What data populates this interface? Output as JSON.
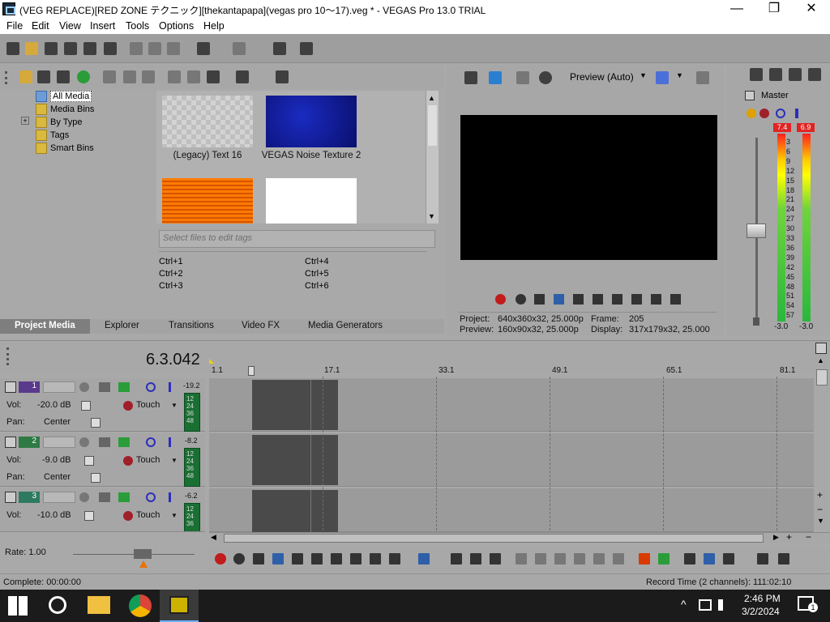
{
  "window": {
    "title": "(VEG REPLACE)[RED ZONE テクニック][thekantapapa](vegas pro 10〜17).veg * - VEGAS Pro 13.0 TRIAL",
    "minimize": "—",
    "maximize": "❐",
    "close": "✕"
  },
  "menu": [
    "File",
    "Edit",
    "View",
    "Insert",
    "Tools",
    "Options",
    "Help"
  ],
  "tree": {
    "items": [
      "All Media",
      "Media Bins",
      "By Type",
      "Tags",
      "Smart Bins"
    ],
    "expander": "+"
  },
  "media": {
    "items": [
      "(Legacy) Text 16",
      "VEGAS Noise Texture 2"
    ],
    "tag_placeholder": "Select files to edit tags",
    "shortcuts": [
      "Ctrl+1",
      "Ctrl+2",
      "Ctrl+3",
      "Ctrl+4",
      "Ctrl+5",
      "Ctrl+6"
    ]
  },
  "tabs": [
    "Project Media",
    "Explorer",
    "Transitions",
    "Video FX",
    "Media Generators"
  ],
  "preview": {
    "mode": "Preview (Auto)",
    "project_label": "Project:",
    "project_value": "640x360x32, 25.000p",
    "preview_label": "Preview:",
    "preview_value": "160x90x32, 25.000p",
    "frame_label": "Frame:",
    "frame_value": "205",
    "display_label": "Display:",
    "display_value": "317x179x32, 25.000"
  },
  "master": {
    "title": "Master",
    "peak_left": "7.4",
    "peak_right": "6.9",
    "scale": [
      "3",
      "6",
      "9",
      "12",
      "15",
      "18",
      "21",
      "24",
      "27",
      "30",
      "33",
      "36",
      "39",
      "42",
      "45",
      "48",
      "51",
      "54",
      "57"
    ],
    "level_left": "-3.0",
    "level_right": "-3.0"
  },
  "timeline": {
    "time": "6.3.042",
    "ruler": [
      "1.1",
      "17.1",
      "33.1",
      "49.1",
      "65.1",
      "81.1"
    ],
    "tracks": [
      {
        "num": "1",
        "peak": "-19.2",
        "vol_label": "Vol:",
        "vol": "-20.0 dB",
        "pan_label": "Pan:",
        "pan": "Center",
        "mode": "Touch",
        "meter": [
          "12",
          "24",
          "36",
          "48"
        ]
      },
      {
        "num": "2",
        "peak": "-8.2",
        "vol_label": "Vol:",
        "vol": "-9.0 dB",
        "pan_label": "Pan:",
        "pan": "Center",
        "mode": "Touch",
        "meter": [
          "12",
          "24",
          "36",
          "48"
        ]
      },
      {
        "num": "3",
        "peak": "-6.2",
        "vol_label": "Vol:",
        "vol": "-10.0 dB",
        "pan_label": "Pan:",
        "pan": "",
        "mode": "Touch",
        "meter": [
          "12",
          "24",
          "36"
        ]
      }
    ],
    "rate": "Rate: 1.00"
  },
  "status": {
    "left": "Complete: 00:00:00",
    "right": "Record Time (2 channels): 111:02:10"
  },
  "taskbar": {
    "time": "2:46 PM",
    "date": "3/2/2024",
    "notif": "1"
  },
  "colors": {
    "panel": "#a7a7a7",
    "clip": "#4a4a4a",
    "meter_green": "#29b83c",
    "peak_red": "#e02323",
    "track1": "#5a3a8c",
    "track2": "#2e7a44",
    "track3": "#2e7a60"
  }
}
